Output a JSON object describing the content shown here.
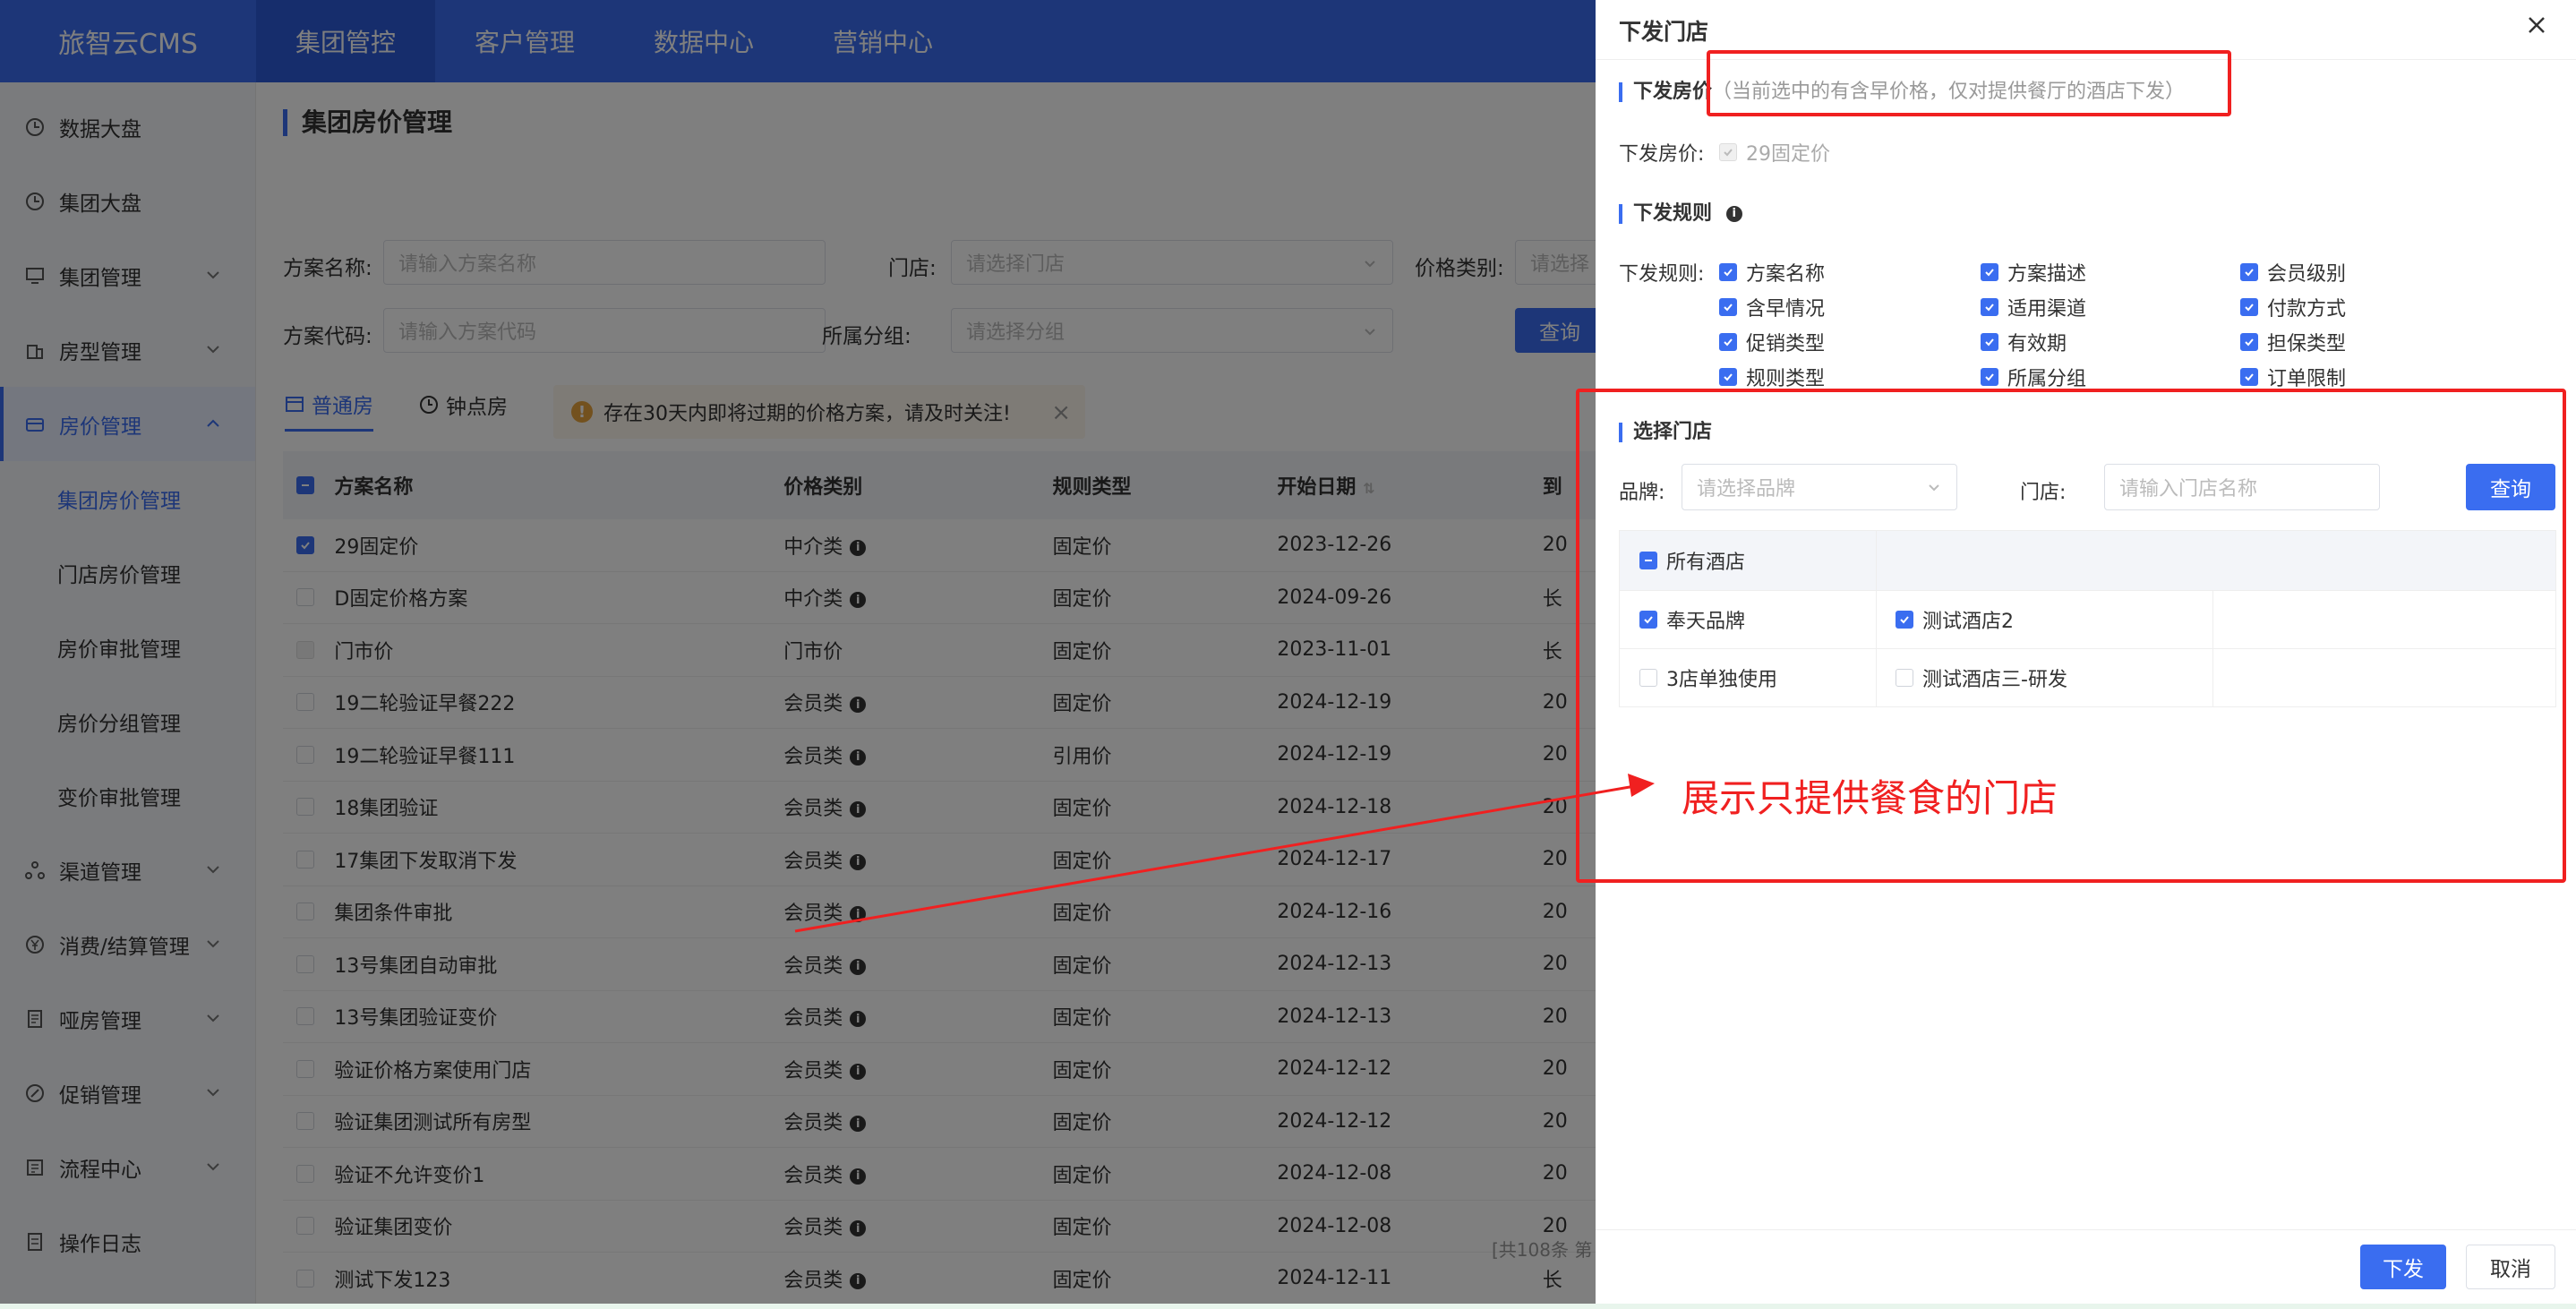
{
  "header": {
    "logo": "旅智云CMS",
    "nav": [
      "集团管控",
      "客户管理",
      "数据中心",
      "营销中心"
    ]
  },
  "sidebar": {
    "items": [
      {
        "label": "数据大盘",
        "icon": "clock-icon",
        "expand": false
      },
      {
        "label": "集团大盘",
        "icon": "clock-icon",
        "expand": false
      },
      {
        "label": "集团管理",
        "icon": "monitor-icon",
        "expand": true
      },
      {
        "label": "房型管理",
        "icon": "building-icon",
        "expand": true
      },
      {
        "label": "房价管理",
        "icon": "card-icon",
        "expand": true,
        "active": true
      },
      {
        "label": "渠道管理",
        "icon": "network-icon",
        "expand": true
      },
      {
        "label": "消费/结算管理",
        "icon": "yen-icon",
        "expand": true
      },
      {
        "label": "哑房管理",
        "icon": "document-icon",
        "expand": true
      },
      {
        "label": "促销管理",
        "icon": "promo-icon",
        "expand": true
      },
      {
        "label": "流程中心",
        "icon": "flow-icon",
        "expand": true
      },
      {
        "label": "操作日志",
        "icon": "log-icon",
        "expand": false
      }
    ],
    "sub_items": [
      "集团房价管理",
      "门店房价管理",
      "房价审批管理",
      "房价分组管理",
      "变价审批管理"
    ]
  },
  "main": {
    "title": "集团房价管理",
    "filters": {
      "plan_name_label": "方案名称:",
      "plan_name_placeholder": "请输入方案名称",
      "store_label": "门店:",
      "store_placeholder": "请选择门店",
      "price_type_label": "价格类别:",
      "price_type_placeholder": "请选择",
      "plan_code_label": "方案代码:",
      "plan_code_placeholder": "请输入方案代码",
      "group_label": "所属分组:",
      "group_placeholder": "请选择分组",
      "query": "查询"
    },
    "tabs": [
      "普通房",
      "钟点房"
    ],
    "alert": "存在30天内即将过期的价格方案，请及时关注!",
    "table": {
      "headers": [
        "方案名称",
        "价格类别",
        "规则类型",
        "开始日期",
        "到"
      ],
      "rows": [
        {
          "name": "29固定价",
          "type": "中介类",
          "info": true,
          "rule": "固定价",
          "date": "2023-12-26",
          "end": "20",
          "checked": true
        },
        {
          "name": "D固定价格方案",
          "type": "中介类",
          "info": true,
          "rule": "固定价",
          "date": "2024-09-26",
          "end": "长",
          "checked": false
        },
        {
          "name": "门市价",
          "type": "门市价",
          "info": false,
          "rule": "固定价",
          "date": "2023-11-01",
          "end": "长",
          "checked": false,
          "disabled": true
        },
        {
          "name": "19二轮验证早餐222",
          "type": "会员类",
          "info": true,
          "rule": "固定价",
          "date": "2024-12-19",
          "end": "20",
          "checked": false
        },
        {
          "name": "19二轮验证早餐111",
          "type": "会员类",
          "info": true,
          "rule": "引用价",
          "date": "2024-12-19",
          "end": "20",
          "checked": false
        },
        {
          "name": "18集团验证",
          "type": "会员类",
          "info": true,
          "rule": "固定价",
          "date": "2024-12-18",
          "end": "20",
          "checked": false
        },
        {
          "name": "17集团下发取消下发",
          "type": "会员类",
          "info": true,
          "rule": "固定价",
          "date": "2024-12-17",
          "end": "20",
          "checked": false
        },
        {
          "name": "集团条件审批",
          "type": "会员类",
          "info": true,
          "rule": "固定价",
          "date": "2024-12-16",
          "end": "20",
          "checked": false
        },
        {
          "name": "13号集团自动审批",
          "type": "会员类",
          "info": true,
          "rule": "固定价",
          "date": "2024-12-13",
          "end": "20",
          "checked": false
        },
        {
          "name": "13号集团验证变价",
          "type": "会员类",
          "info": true,
          "rule": "固定价",
          "date": "2024-12-13",
          "end": "20",
          "checked": false
        },
        {
          "name": "验证价格方案使用门店",
          "type": "会员类",
          "info": true,
          "rule": "固定价",
          "date": "2024-12-12",
          "end": "20",
          "checked": false
        },
        {
          "name": "验证集团测试所有房型",
          "type": "会员类",
          "info": true,
          "rule": "固定价",
          "date": "2024-12-12",
          "end": "20",
          "checked": false
        },
        {
          "name": "验证不允许变价1",
          "type": "会员类",
          "info": true,
          "rule": "固定价",
          "date": "2024-12-08",
          "end": "20",
          "checked": false
        },
        {
          "name": "验证集团变价",
          "type": "会员类",
          "info": true,
          "rule": "固定价",
          "date": "2024-12-08",
          "end": "20",
          "checked": false
        },
        {
          "name": "测试下发123",
          "type": "会员类",
          "info": true,
          "rule": "固定价",
          "date": "2024-12-11",
          "end": "长",
          "checked": false
        }
      ]
    },
    "pager": "[共108条 第"
  },
  "drawer": {
    "title": "下发门店",
    "price_section": "下发房价",
    "price_hint": "（当前选中的有含早价格，仅对提供餐厅的酒店下发）",
    "price_label": "下发房价:",
    "price_value": "29固定价",
    "rules_section": "下发规则",
    "rules_label": "下发规则:",
    "rules": [
      [
        "方案名称",
        "方案描述",
        "会员级别"
      ],
      [
        "含早情况",
        "适用渠道",
        "付款方式"
      ],
      [
        "促销类型",
        "有效期",
        "担保类型"
      ],
      [
        "规则类型",
        "所属分组",
        "订单限制"
      ]
    ],
    "store_section": "选择门店",
    "brand_label": "品牌:",
    "brand_placeholder": "请选择品牌",
    "store_label": "门店:",
    "store_placeholder": "请输入门店名称",
    "query": "查询",
    "all_hotels": "所有酒店",
    "grid_rows": [
      {
        "brand": "奉天品牌",
        "brand_checked": true,
        "hotel": "测试酒店2",
        "hotel_checked": true
      },
      {
        "brand": "3店单独使用",
        "brand_checked": false,
        "hotel": "测试酒店三-研发",
        "hotel_checked": false
      }
    ],
    "submit": "下发",
    "cancel": "取消"
  },
  "annotation": {
    "text": "展示只提供餐食的门店",
    "color": "#f02020"
  },
  "colors": {
    "primary": "#3a6df0",
    "annotation": "#f02020",
    "alert_bg": "#fdf6ec"
  }
}
